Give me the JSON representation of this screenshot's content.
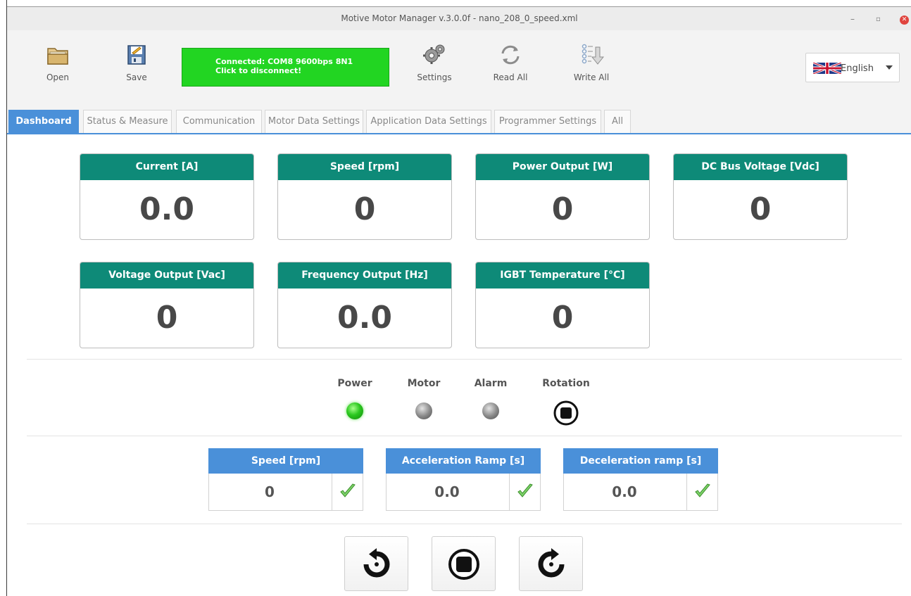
{
  "window": {
    "title": "Motive Motor Manager v.3.0.0f - nano_208_0_speed.xml",
    "controls": {
      "minimize": "–",
      "restore": "▫",
      "close": "✕"
    }
  },
  "toolbar": {
    "open_label": "Open",
    "save_label": "Save",
    "connection_line1": "Connected: COM8 9600bps 8N1",
    "connection_line2": "Click to disconnect!",
    "settings_label": "Settings",
    "read_all_label": "Read All",
    "write_all_label": "Write All",
    "language": "English"
  },
  "tabs": [
    {
      "label": "Dashboard",
      "active": true
    },
    {
      "label": "Status & Measure"
    },
    {
      "label": "Communication"
    },
    {
      "label": "Motor Data Settings"
    },
    {
      "label": "Application Data Settings"
    },
    {
      "label": "Programmer Settings"
    },
    {
      "label": "All"
    }
  ],
  "gauges": [
    {
      "title": "Current [A]",
      "value": "0.0"
    },
    {
      "title": "Speed [rpm]",
      "value": "0"
    },
    {
      "title": "Power Output [W]",
      "value": "0"
    },
    {
      "title": "DC Bus Voltage [Vdc]",
      "value": "0"
    },
    {
      "title": "Voltage Output [Vac]",
      "value": "0"
    },
    {
      "title": "Frequency Output [Hz]",
      "value": "0.0"
    },
    {
      "title": "IGBT Temperature [°C]",
      "value": "0"
    }
  ],
  "indicators": [
    {
      "label": "Power",
      "state": "on-green"
    },
    {
      "label": "Motor",
      "state": "off"
    },
    {
      "label": "Alarm",
      "state": "off"
    },
    {
      "label": "Rotation",
      "state": "stopped"
    }
  ],
  "setpoints": [
    {
      "title": "Speed [rpm]",
      "value": "0"
    },
    {
      "title": "Acceleration Ramp [s]",
      "value": "0.0"
    },
    {
      "title": "Deceleration ramp [s]",
      "value": "0.0"
    }
  ],
  "controls": {
    "rotate_ccw_icon": "rotate-ccw-icon",
    "stop_icon": "stop-icon",
    "rotate_cw_icon": "rotate-cw-icon"
  },
  "colors": {
    "gauge_header": "#0e8a78",
    "setpoint_header": "#4a90d9",
    "tab_active": "#4a90d9",
    "connected": "#22d522",
    "power_led": "#2bc81f"
  }
}
